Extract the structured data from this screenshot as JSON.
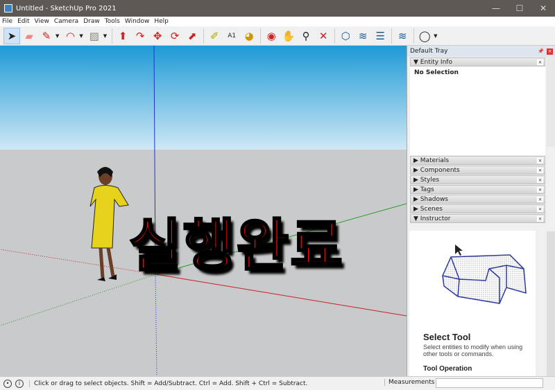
{
  "window": {
    "title": "Untitled - SketchUp Pro 2021",
    "minimize": "—",
    "maximize": "☐",
    "close": "✕"
  },
  "menu": [
    "File",
    "Edit",
    "View",
    "Camera",
    "Draw",
    "Tools",
    "Window",
    "Help"
  ],
  "overlay_text": "실행완료",
  "tray": {
    "title": "Default Tray",
    "entity_info": "Entity Info",
    "no_selection": "No Selection",
    "panels": [
      "Materials",
      "Components",
      "Styles",
      "Tags",
      "Shadows",
      "Scenes",
      "Instructor"
    ]
  },
  "instructor": {
    "title": "Select Tool",
    "description": "Select entities to modify when using other tools or commands.",
    "section": "Tool Operation"
  },
  "status": {
    "message": "Click or drag to select objects. Shift = Add/Subtract. Ctrl = Add. Shift + Ctrl = Subtract.",
    "measurements_label": "Measurements",
    "measurements_value": ""
  }
}
